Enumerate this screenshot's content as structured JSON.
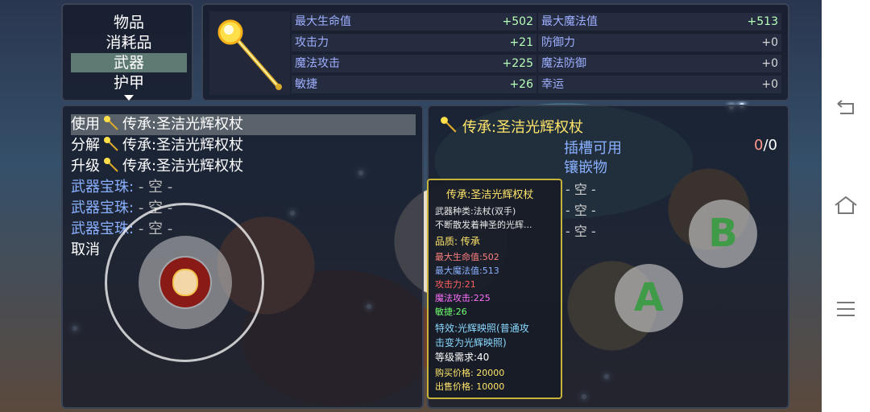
{
  "categories": {
    "items": [
      "物品",
      "消耗品",
      "武器",
      "护甲"
    ],
    "selected_index": 2
  },
  "stats": [
    {
      "name": "最大生命值",
      "value": "+502"
    },
    {
      "name": "最大魔法值",
      "value": "+513"
    },
    {
      "name": "攻击力",
      "value": "+21"
    },
    {
      "name": "防御力",
      "value": "+0"
    },
    {
      "name": "魔法攻击",
      "value": "+225"
    },
    {
      "name": "魔法防御",
      "value": "+0"
    },
    {
      "name": "敏捷",
      "value": "+26"
    },
    {
      "name": "幸运",
      "value": "+0"
    }
  ],
  "actions": {
    "use": {
      "label": "使用",
      "item": "传承:圣洁光辉权杖"
    },
    "decompose": {
      "label": "分解",
      "item": "传承:圣洁光辉权杖"
    },
    "upgrade": {
      "label": "升级",
      "item": "传承:圣洁光辉权杖"
    },
    "gem_label": "武器宝珠:",
    "gem_empty": "- 空 -",
    "cancel": "取消"
  },
  "detail": {
    "title": "传承:圣洁光辉权杖",
    "slot_label": "插槽可用",
    "inlay_label": "镶嵌物",
    "slot_current": "0",
    "slot_total": "/0",
    "empty": "- 空 -"
  },
  "tooltip": {
    "name": "传承:圣洁光辉权杖",
    "type": "武器种类:法杖(双手)",
    "desc": "不断散发着神圣的光辉...",
    "quality": "品质: 传承",
    "hp": "最大生命值:502",
    "mp": "最大魔法值:513",
    "atk": "攻击力:21",
    "matk": "魔法攻击:225",
    "agi": "敏捷:26",
    "effect1": "特效:光辉映照(普通攻",
    "effect2": "击变为光辉映照)",
    "level": "等级需求:40",
    "buy": "购买价格: 20000",
    "sell": "出售价格: 10000"
  },
  "buttons": {
    "a": "A",
    "b": "B"
  },
  "colors": {
    "gold": "#ffe66b",
    "stat_name": "#9fb0ff",
    "stat_value": "#b8ffb8",
    "tooltip_border": "#c8b33a",
    "button_letter": "#3f9b48"
  }
}
